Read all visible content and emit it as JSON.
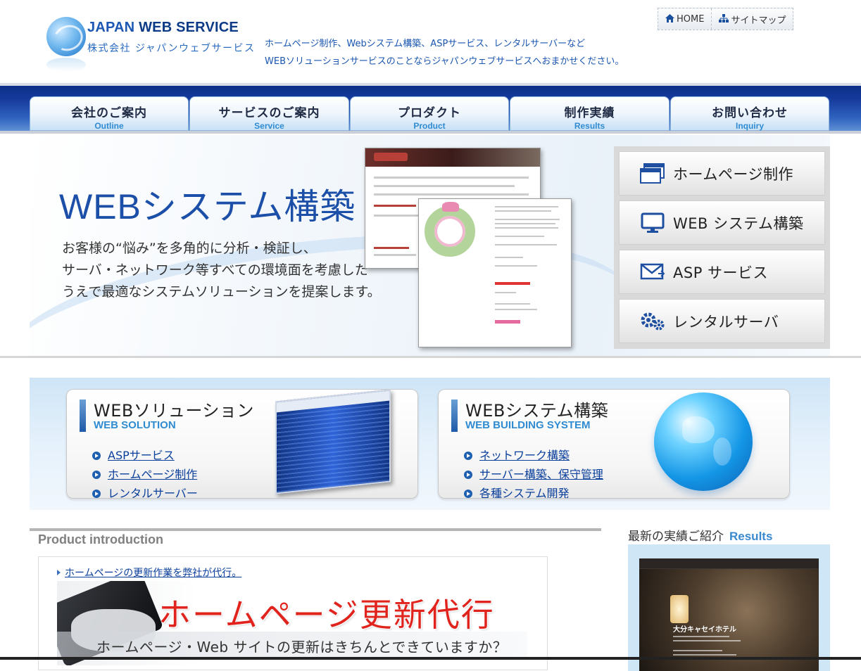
{
  "header": {
    "logo_en_a": "JAPAN ",
    "logo_en_b": "WEB SERVICE",
    "logo_jp": "株式会社 ジャパンウェブサービス",
    "tagline_1": "ホームページ制作、Webシステム構築、ASPサービス、レンタルサーバーなど",
    "tagline_2": "WEBソリューションサービスのことならジャパンウェブサービスへおまかせください。",
    "top_links": [
      {
        "label": "HOME",
        "icon": "home-icon"
      },
      {
        "label": "サイトマップ",
        "icon": "sitemap-icon"
      }
    ]
  },
  "nav": [
    {
      "jp": "会社のご案内",
      "en": "Outline"
    },
    {
      "jp": "サービスのご案内",
      "en": "Service"
    },
    {
      "jp": "プロダクト",
      "en": "Product"
    },
    {
      "jp": "制作実績",
      "en": "Results"
    },
    {
      "jp": "お問い合わせ",
      "en": "Inquiry"
    }
  ],
  "hero": {
    "title": "WEBシステム構築",
    "desc_1": "お客様の“悩み”を多角的に分析・検証し、",
    "desc_2": "サーバ・ネットワーク等すべての環境面を考慮した",
    "desc_3": "うえで最適なシステムソリューションを提案します。"
  },
  "side_menu": [
    {
      "label": "ホームページ制作",
      "icon": "browser-windows-icon"
    },
    {
      "label": "WEB システム構築",
      "icon": "monitor-icon"
    },
    {
      "label": "ASP サービス",
      "icon": "mail-icon"
    },
    {
      "label": "レンタルサーバ",
      "icon": "gears-icon"
    }
  ],
  "solutions": [
    {
      "title": "WEBソリューション",
      "subtitle": "WEB SOLUTION",
      "links": [
        "ASPサービス",
        "ホームページ制作",
        "レンタルサーバー"
      ]
    },
    {
      "title": "WEBシステム構築",
      "subtitle": "WEB BUILDING SYSTEM",
      "links": [
        "ネットワーク構築",
        "サーバー構築、保守管理",
        "各種システム開発"
      ]
    }
  ],
  "product": {
    "heading": "Product introduction",
    "link": "ホームページの更新作業を弊社が代行。",
    "banner_title": "ホームページ更新代行",
    "banner_sub": "ホームページ・Web サイトの更新はきちんとできていますか？"
  },
  "results": {
    "heading_jp": "最新の実績ご紹介",
    "heading_en": "Results",
    "shot_title": "大分キャセイホテル"
  },
  "colors": {
    "brand_blue": "#1b4fa8",
    "nav_dark": "#0c2f86",
    "link": "#0a3f9b",
    "accent_red": "#e0231c"
  }
}
